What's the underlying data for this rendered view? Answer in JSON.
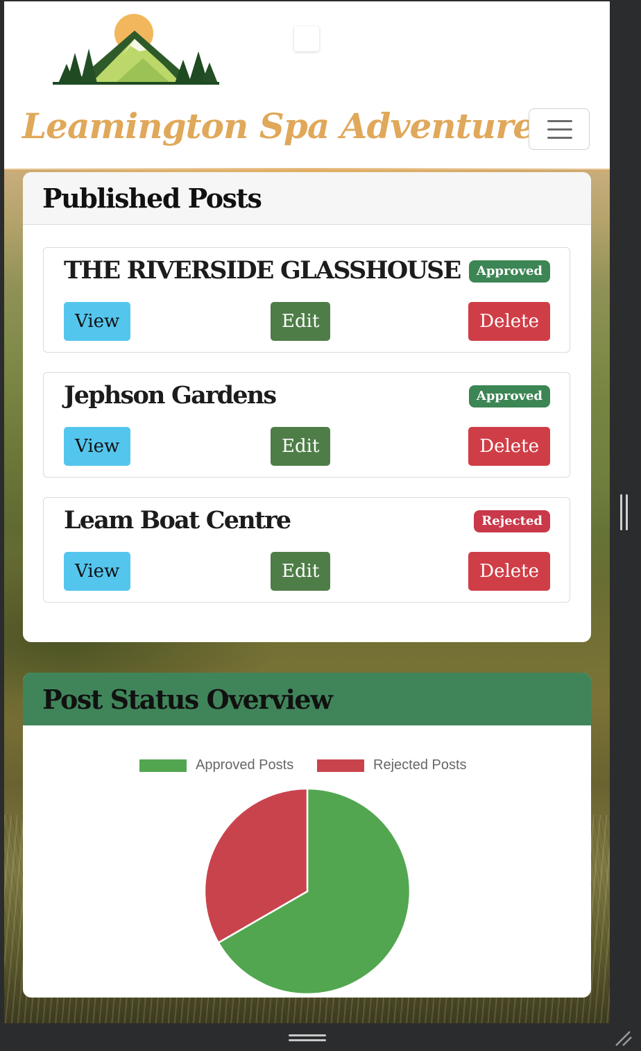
{
  "header": {
    "brand": "Leamington Spa Adventures",
    "logo_icon": "mountain-sun-logo",
    "menu_icon": "hamburger-icon"
  },
  "posts_card": {
    "title": "Published Posts",
    "posts": [
      {
        "title": "THE RIVERSIDE GLASSHOUSE",
        "status": "Approved",
        "view": "View",
        "edit": "Edit",
        "delete": "Delete"
      },
      {
        "title": "Jephson Gardens",
        "status": "Approved",
        "view": "View",
        "edit": "Edit",
        "delete": "Delete"
      },
      {
        "title": "Leam Boat Centre",
        "status": "Rejected",
        "view": "View",
        "edit": "Edit",
        "delete": "Delete"
      }
    ]
  },
  "chart_card": {
    "title": "Post Status Overview"
  },
  "chart_data": {
    "type": "pie",
    "categories": [
      "Approved Posts",
      "Rejected Posts"
    ],
    "values": [
      2,
      1
    ],
    "colors": [
      "#52a650",
      "#c9434d"
    ],
    "legend": "top"
  },
  "colors": {
    "brand": "#e0a85a",
    "approved": "#3c8554",
    "rejected": "#c9394a",
    "view_button": "#54c6ee",
    "edit_button": "#4e7d47",
    "delete_button": "#cf3e47",
    "chart_header": "#40855a"
  }
}
